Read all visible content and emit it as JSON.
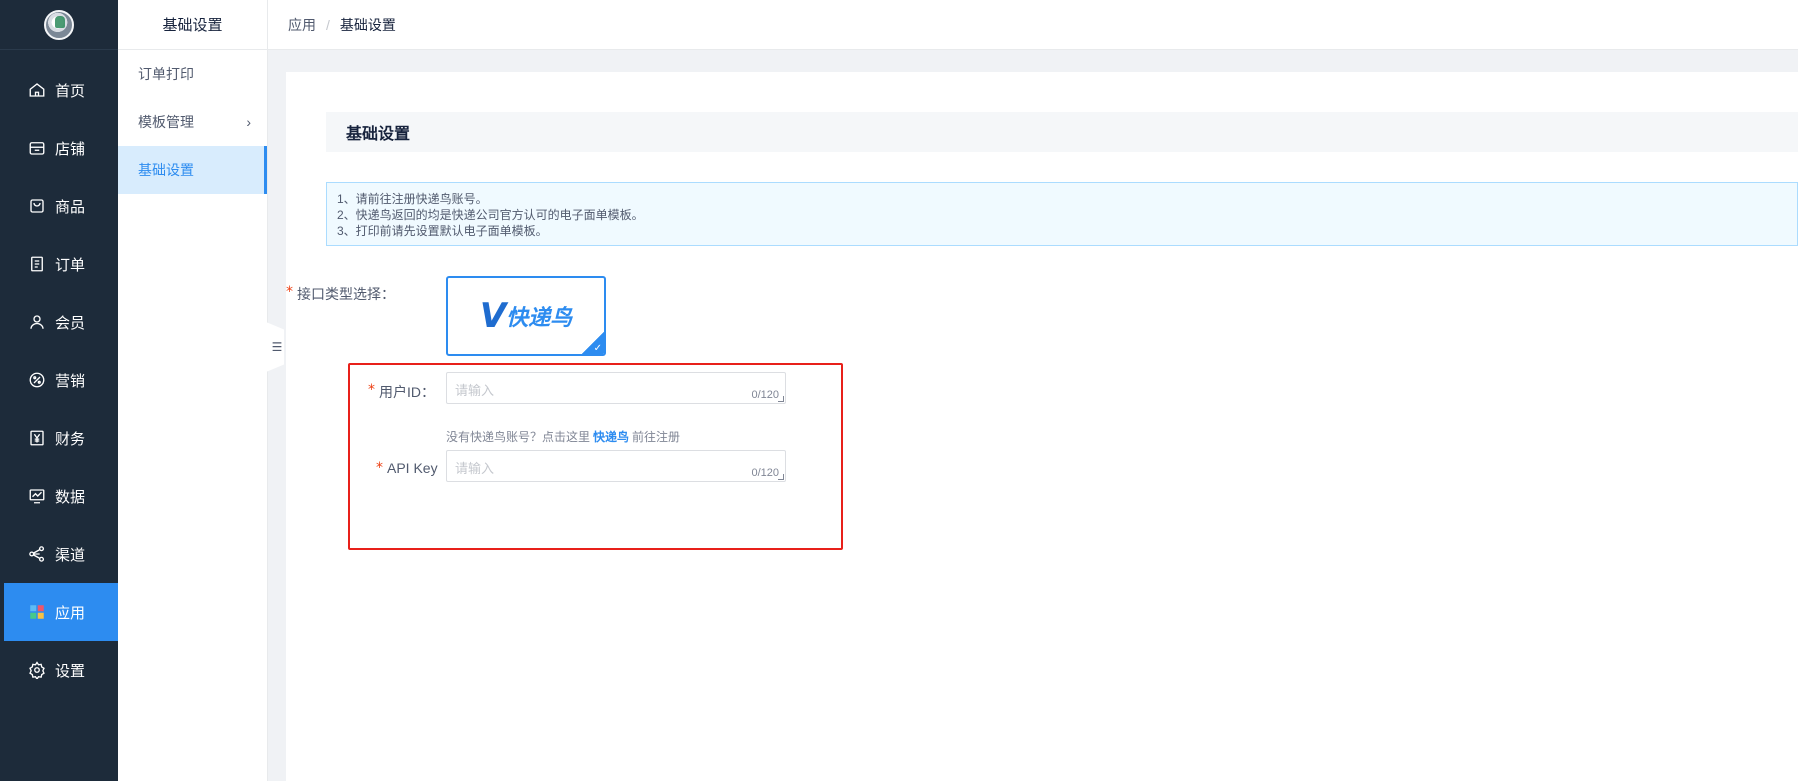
{
  "nav": {
    "items": [
      {
        "label": "首页",
        "icon": "home-icon"
      },
      {
        "label": "店铺",
        "icon": "store-icon"
      },
      {
        "label": "商品",
        "icon": "bag-icon"
      },
      {
        "label": "订单",
        "icon": "document-icon"
      },
      {
        "label": "会员",
        "icon": "user-icon"
      },
      {
        "label": "营销",
        "icon": "marketing-icon"
      },
      {
        "label": "财务",
        "icon": "yen-icon"
      },
      {
        "label": "数据",
        "icon": "chart-icon"
      },
      {
        "label": "渠道",
        "icon": "share-icon"
      },
      {
        "label": "应用",
        "icon": "apps-icon"
      },
      {
        "label": "设置",
        "icon": "gear-icon"
      }
    ],
    "active": "应用"
  },
  "submenu": {
    "title": "基础设置",
    "items": [
      {
        "label": "订单打印"
      },
      {
        "label": "模板管理"
      },
      {
        "label": "基础设置"
      }
    ]
  },
  "breadcrumb": {
    "parent": "应用",
    "separator": "/",
    "current": "基础设置"
  },
  "section": {
    "title": "基础设置"
  },
  "notice": {
    "lines": [
      "1、请前往注册快递鸟账号。",
      "2、快递鸟返回的均是快递公司官方认可的电子面单模板。",
      "3、打印前请先设置默认电子面单模板。"
    ]
  },
  "form": {
    "required_mark": "*",
    "interface_label": "接口类型选择：",
    "interface_option": {
      "logo_mark": "V",
      "logo_text": "快递鸟",
      "check": "✓"
    },
    "user_id": {
      "label": "用户ID：",
      "placeholder": "请输入",
      "counter": "0/120"
    },
    "hint": {
      "before": "没有快递鸟账号？点击这里",
      "link": "快递鸟",
      "after": "前往注册"
    },
    "api_key": {
      "label": "API Key",
      "placeholder": "请输入",
      "counter": "0/120"
    }
  },
  "colors": {
    "nav_bg": "#1d2b3a",
    "accent": "#2d8cf0",
    "highlight_box": "#e8201a",
    "required": "#ed4014"
  }
}
